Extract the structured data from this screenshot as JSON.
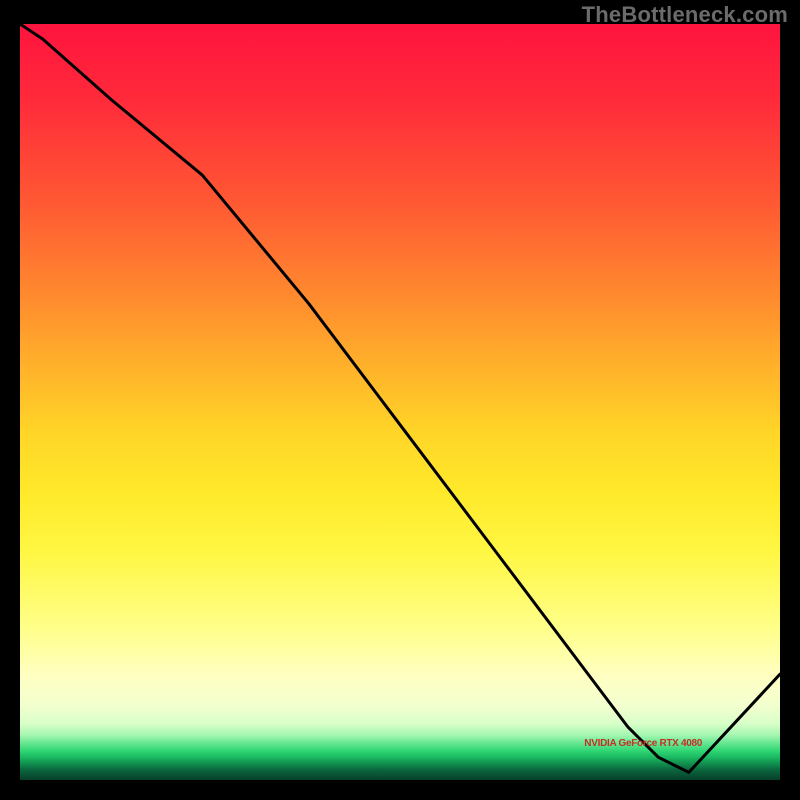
{
  "watermark": "TheBottleneck.com",
  "annotation_label": "NVIDIA GeForce RTX 4080",
  "chart_data": {
    "type": "line",
    "title": "",
    "xlabel": "",
    "ylabel": "",
    "xlim": [
      0,
      100
    ],
    "ylim": [
      0,
      100
    ],
    "x": [
      0,
      3,
      12,
      24,
      38,
      50,
      62,
      74,
      80,
      84,
      88,
      100
    ],
    "values": [
      100,
      98,
      90,
      80,
      63,
      47,
      31,
      15,
      7,
      3,
      1,
      14
    ],
    "min_point": {
      "x": 86,
      "y": 1
    },
    "annotation": {
      "x": 82,
      "y": 4,
      "text": "NVIDIA GeForce RTX 4080"
    }
  },
  "colors": {
    "line": "#000000",
    "annotation": "#c23027",
    "watermark": "#6b6b6b"
  }
}
